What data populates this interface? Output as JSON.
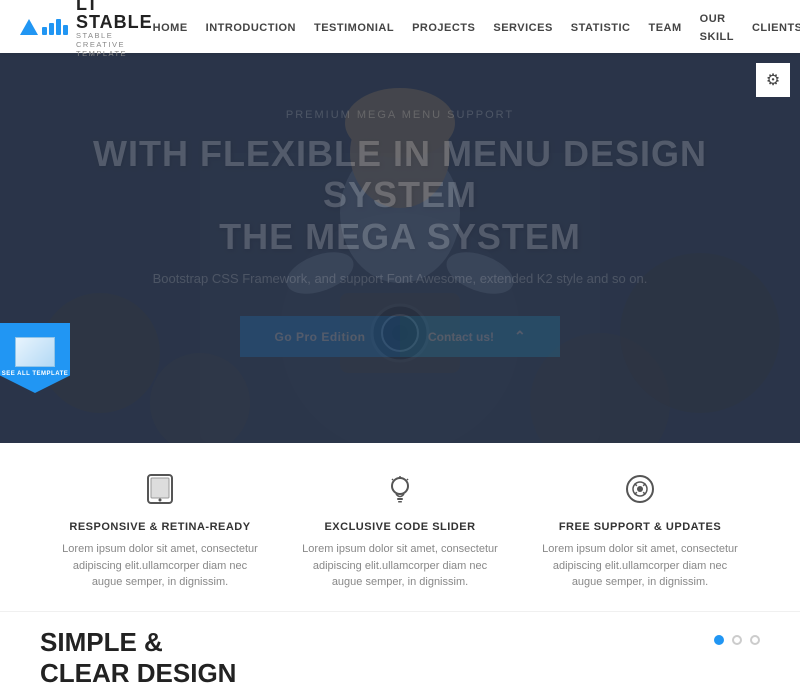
{
  "brand": {
    "name": "LT STABLE",
    "sub": "STABLE CREATIVE TEMPLATE"
  },
  "nav": {
    "links": [
      "HOME",
      "INTRODUCTION",
      "TESTIMONIAL",
      "PROJECTS",
      "SERVICES",
      "STATISTIC",
      "TEAM",
      "OUR SKILL",
      "CLIENTS"
    ]
  },
  "hero": {
    "eyebrow": "PREMIUM MEGA MENU SUPPORT",
    "title_line1": "WITH FLEXIBLE IN MENU DESIGN SYSTEM",
    "title_line2": "THE MEGA SYSTEM",
    "subtitle": "Bootstrap CSS Framework, and support Font Awesome, extended K2 style and so on.",
    "btn_pro": "Go Pro Edition",
    "btn_contact": "Contact us!"
  },
  "badge": {
    "label": "SEE ALL TEMPLATE"
  },
  "features": [
    {
      "icon": "tablet",
      "title": "RESPONSIVE & RETINA-READY",
      "desc": "Lorem ipsum dolor sit amet, consectetur adipiscing elit.ullamcorper diam nec augue semper, in dignissim."
    },
    {
      "icon": "bulb",
      "title": "EXCLUSIVE CODE SLIDER",
      "desc": "Lorem ipsum dolor sit amet, consectetur adipiscing elit.ullamcorper diam nec augue semper, in dignissim."
    },
    {
      "icon": "support",
      "title": "FREE SUPPORT & UPDATES",
      "desc": "Lorem ipsum dolor sit amet, consectetur adipiscing elit.ullamcorper diam nec augue semper, in dignissim."
    }
  ],
  "bottom": {
    "title_line1": "SIMPLE &",
    "title_line2": "CLEAR DESIGN"
  }
}
